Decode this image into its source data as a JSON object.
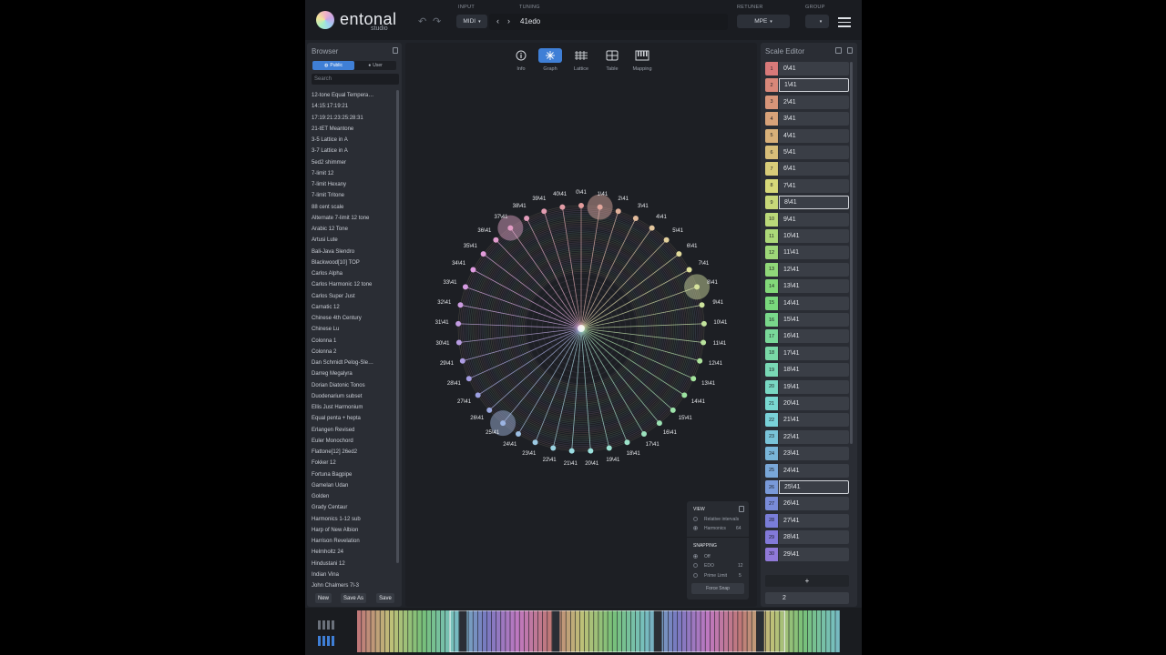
{
  "app": {
    "logo_text": "entonal",
    "logo_sub": "studio"
  },
  "header": {
    "input_label": "INPUT",
    "input_value": "MIDI",
    "tuning_label": "TUNING",
    "tuning_value": "41edo",
    "retuner_label": "RETUNER",
    "retuner_value": "MPE",
    "group_label": "GROUP"
  },
  "browser": {
    "title": "Browser",
    "tab_public": "Public",
    "tab_user": "User",
    "search_placeholder": "Search",
    "items": [
      "12-tone Equal Tempera…",
      "14:15:17:19:21",
      "17:19:21:23:25:28:31",
      "21-tET Meantone",
      "3-5 Lattice in A",
      "3-7 Lattice in A",
      "5ed2 shimmer",
      "7-limit 12",
      "7-limit Hexany",
      "7-limit Tritone",
      "88 cent scale",
      "Alternate 7-limit 12 tone",
      "Arabic 12 Tone",
      "Artusi Lute",
      "Bali-Java Slendro",
      "Blackwood[10] TOP",
      "Carlos Alpha",
      "Carlos Harmonic 12 tone",
      "Carlos Super Just",
      "Carnatic 12",
      "Chinese 4th Century",
      "Chinese Lu",
      "Colonna 1",
      "Colonna 2",
      "Dan Schmidt Pelog-Sle…",
      "Darreg Megalyra",
      "Dorian Diatonic Tonos",
      "Duodenarium subset",
      "Ellis Just Harmonium",
      "Equal penta + hepta",
      "Erlangen Revised",
      "Euler Monochord",
      "Flattone[12] 26ed2",
      "Fokker 12",
      "Fortuna Bagpipe",
      "Gamelan Udan",
      "Golden",
      "Grady Centaur",
      "Harmonics 1-12 sub",
      "Harp of New Albion",
      "Harrison Revelation",
      "Helmholtz 24",
      "Hindustani 12",
      "Indian Vina",
      "John Chalmers 7l-3"
    ],
    "btn_new": "New",
    "btn_save_as": "Save As",
    "btn_save": "Save"
  },
  "views": [
    {
      "label": "Info",
      "icon": "info-icon"
    },
    {
      "label": "Graph",
      "icon": "graph-icon",
      "active": true
    },
    {
      "label": "Lattice",
      "icon": "lattice-icon"
    },
    {
      "label": "Table",
      "icon": "table-icon"
    },
    {
      "label": "Mapping",
      "icon": "piano-icon"
    }
  ],
  "graph": {
    "edo": 41,
    "labels": [
      "0\\41",
      "1\\41",
      "2\\41",
      "3\\41",
      "4\\41",
      "5\\41",
      "6\\41",
      "7\\41",
      "8\\41",
      "9\\41",
      "10\\41",
      "11\\41",
      "12\\41",
      "13\\41",
      "14\\41",
      "15\\41",
      "16\\41",
      "17\\41",
      "18\\41",
      "19\\41",
      "20\\41",
      "21\\41",
      "22\\41",
      "23\\41",
      "24\\41",
      "25\\41",
      "26\\41",
      "27\\41",
      "28\\41",
      "29\\41",
      "30\\41",
      "31\\41",
      "32\\41",
      "33\\41",
      "34\\41",
      "35\\41",
      "36\\41",
      "37\\41",
      "38\\41",
      "39\\41",
      "40\\41"
    ],
    "highlighted_steps": [
      1,
      8,
      25,
      37
    ]
  },
  "view_panel": {
    "view_title": "VIEW",
    "relative_intervals": "Relative intervals",
    "harmonics": "Harmonics",
    "harmonics_value": "64",
    "snapping_title": "SNAPPING",
    "off": "Off",
    "edo": "EDO",
    "edo_value": "12",
    "prime_limit": "Prime Limit",
    "prime_limit_value": "5",
    "force_snap": "Force Snap"
  },
  "scale_editor": {
    "title": "Scale Editor",
    "rows": [
      {
        "n": "1",
        "v": "0\\41"
      },
      {
        "n": "2",
        "v": "1\\41",
        "sel": true
      },
      {
        "n": "3",
        "v": "2\\41"
      },
      {
        "n": "4",
        "v": "3\\41"
      },
      {
        "n": "5",
        "v": "4\\41"
      },
      {
        "n": "6",
        "v": "5\\41"
      },
      {
        "n": "7",
        "v": "6\\41"
      },
      {
        "n": "8",
        "v": "7\\41"
      },
      {
        "n": "9",
        "v": "8\\41",
        "sel": true
      },
      {
        "n": "10",
        "v": "9\\41"
      },
      {
        "n": "11",
        "v": "10\\41"
      },
      {
        "n": "12",
        "v": "11\\41"
      },
      {
        "n": "13",
        "v": "12\\41"
      },
      {
        "n": "14",
        "v": "13\\41"
      },
      {
        "n": "15",
        "v": "14\\41"
      },
      {
        "n": "16",
        "v": "15\\41"
      },
      {
        "n": "17",
        "v": "16\\41"
      },
      {
        "n": "18",
        "v": "17\\41"
      },
      {
        "n": "19",
        "v": "18\\41"
      },
      {
        "n": "20",
        "v": "19\\41"
      },
      {
        "n": "21",
        "v": "20\\41"
      },
      {
        "n": "22",
        "v": "21\\41"
      },
      {
        "n": "23",
        "v": "22\\41"
      },
      {
        "n": "24",
        "v": "23\\41"
      },
      {
        "n": "25",
        "v": "24\\41"
      },
      {
        "n": "26",
        "v": "25\\41",
        "sel": true
      },
      {
        "n": "27",
        "v": "26\\41"
      },
      {
        "n": "28",
        "v": "27\\41"
      },
      {
        "n": "29",
        "v": "28\\41"
      },
      {
        "n": "30",
        "v": "29\\41"
      }
    ],
    "add_label": "+",
    "footer_value": "2"
  },
  "colors": {
    "accent": "#3f7fd6",
    "panel": "#2a2d34",
    "background": "#202329"
  }
}
